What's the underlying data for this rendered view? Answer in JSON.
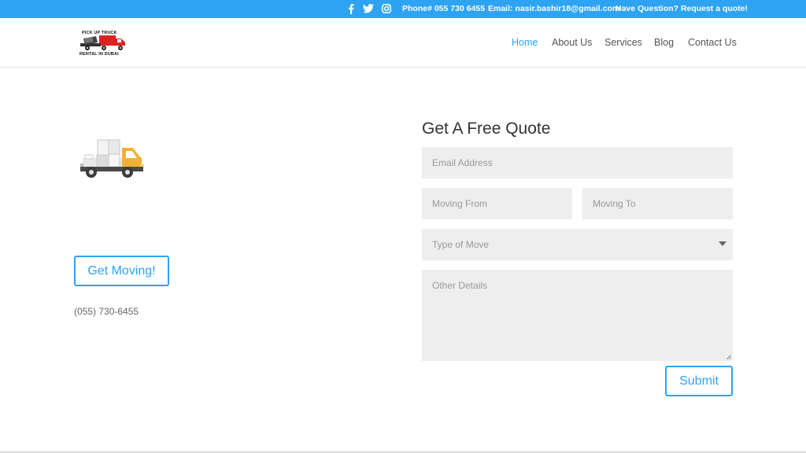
{
  "topbar": {
    "bg_color": "#2ea3f2",
    "social_icons": [
      "facebook-icon",
      "twitter-icon",
      "instagram-icon"
    ],
    "phone": "Phone# 055 730 6455",
    "email": "Email: nasir.bashir18@gmail.com",
    "cta": "Have Question? Request a quote!"
  },
  "header": {
    "logo_line1": "PICK UP TRUCK",
    "logo_line2": "RENTAL IN DUBAI",
    "nav": [
      "Home",
      "About Us",
      "Services",
      "Blog",
      "Contact Us"
    ],
    "active_nav": "Home",
    "accent_color": "#2ea3f2"
  },
  "left": {
    "illustration": "moving-truck-icon",
    "button_label": "Get Moving!",
    "phone": "(055) 730-6455"
  },
  "form": {
    "title": "Get A Free Quote",
    "email_placeholder": "Email Address",
    "from_placeholder": "Moving From",
    "to_placeholder": "Moving To",
    "move_type_placeholder": "Type of Move",
    "details_placeholder": "Other Details",
    "submit_label": "Submit"
  }
}
